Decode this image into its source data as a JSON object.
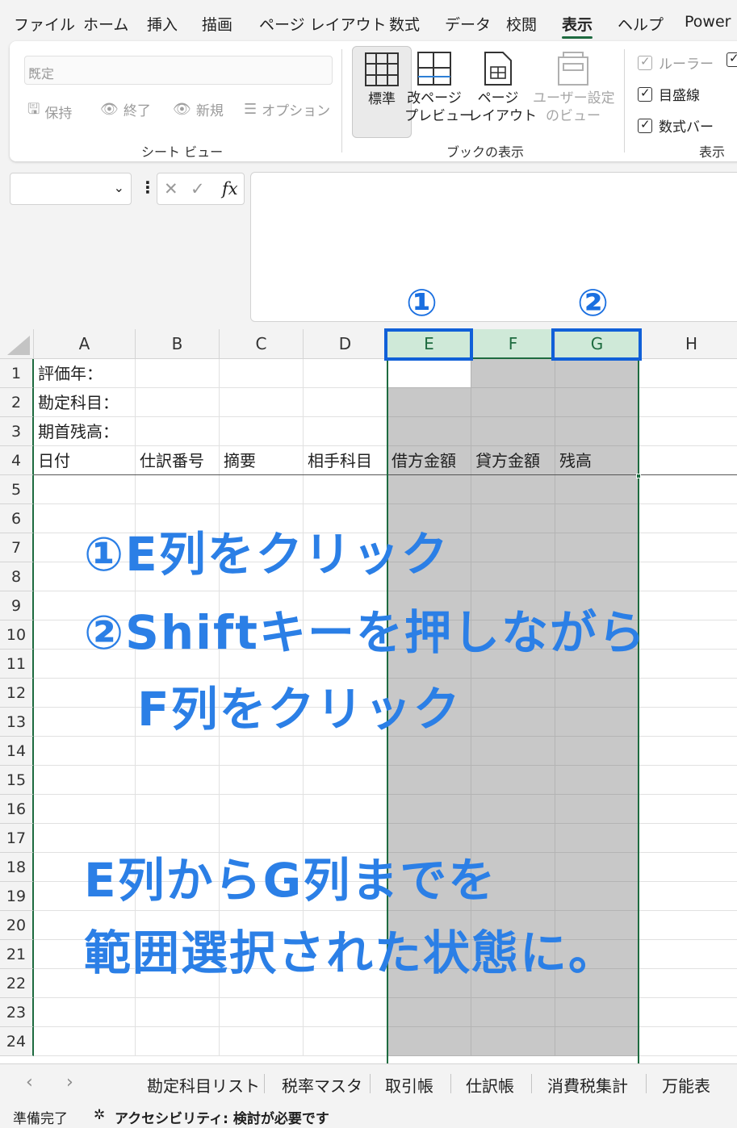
{
  "menu": {
    "tabs": [
      "ファイル",
      "ホーム",
      "挿入",
      "描画",
      "ページ レイアウト",
      "数式",
      "データ",
      "校閲",
      "表示",
      "ヘルプ",
      "Power"
    ],
    "active": "表示"
  },
  "ribbon": {
    "sheet_view": {
      "select_value": "既定",
      "keep": "保持",
      "exit": "終了",
      "new": "新規",
      "options": "オプション",
      "label": "シート ビュー"
    },
    "workbook_views": {
      "normal": "標準",
      "page_break_1": "改ページ",
      "page_break_2": "プレビュー",
      "page_layout_1": "ページ",
      "page_layout_2": "レイアウト",
      "custom_1": "ユーザー設定",
      "custom_2": "のビュー",
      "label": "ブックの表示"
    },
    "show": {
      "ruler": "ルーラー",
      "gridlines": "目盛線",
      "formula_bar": "数式バー",
      "label": "表示"
    }
  },
  "formula_bar": {
    "fx": "fx"
  },
  "annotations": {
    "num1": "①",
    "num2": "②",
    "line1": "①E列をクリック",
    "line2": "②Shiftキーを押しながら",
    "line3": "F列をクリック",
    "line4": "E列からG列までを",
    "line5": "範囲選択された状態に。"
  },
  "grid": {
    "columns": [
      "A",
      "B",
      "C",
      "D",
      "E",
      "F",
      "G",
      "H"
    ],
    "rows": [
      "1",
      "2",
      "3",
      "4",
      "5",
      "6",
      "7",
      "8",
      "9",
      "10",
      "11",
      "12",
      "13",
      "14",
      "15",
      "16",
      "17",
      "18",
      "19",
      "20",
      "21",
      "22",
      "23",
      "24"
    ],
    "cells": {
      "A1": "評価年：",
      "A2": "勘定科目：",
      "A3": "期首残高：",
      "A4": "日付",
      "B4": "仕訳番号",
      "C4": "摘要",
      "D4": "相手科目",
      "E4": "借方金額",
      "F4": "貸方金額",
      "G4": "残高"
    }
  },
  "sheet_tabs": [
    "勘定科目リスト",
    "税率マスタ",
    "取引帳",
    "仕訳帳",
    "消費税集計",
    "万能表"
  ],
  "status": {
    "ready": "準備完了",
    "accessibility": "アクセシビリティ: 検討が必要です"
  },
  "colors": {
    "accent_green": "#1e6b40",
    "annotation_blue": "#2b7fe6",
    "selection_gray": "#c8c8c8"
  }
}
